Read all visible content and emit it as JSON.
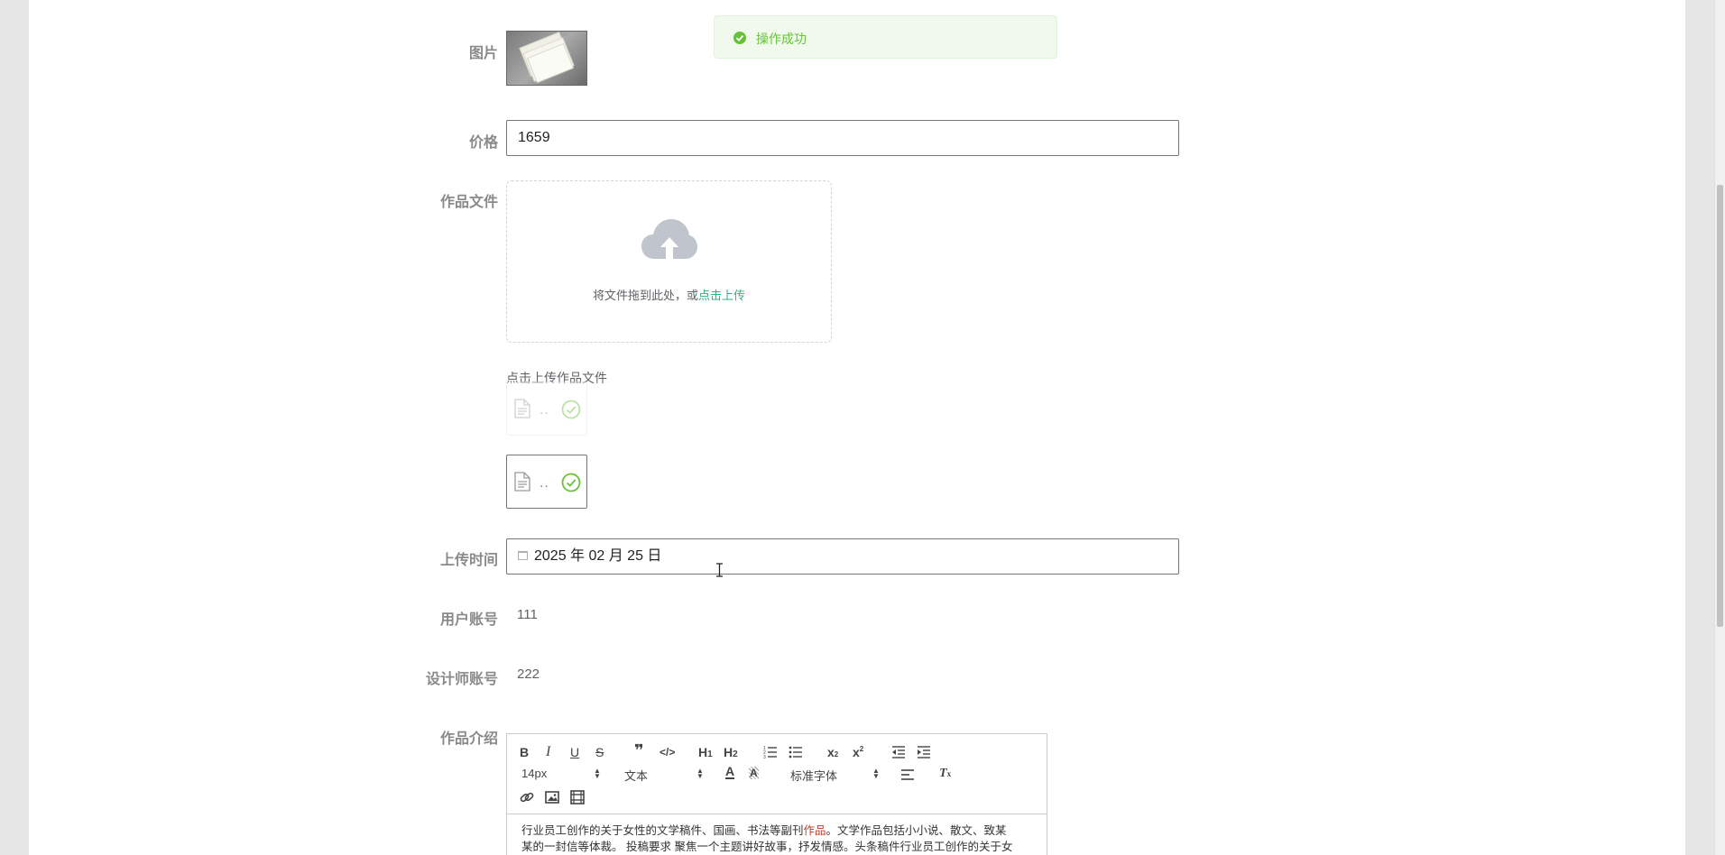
{
  "toast": {
    "message": "操作成功",
    "color": "#67c23a"
  },
  "form": {
    "image": {
      "label": "图片",
      "thumbnail_alt": "作品图片"
    },
    "price": {
      "label": "价格",
      "value": "1659"
    },
    "file": {
      "label": "作品文件",
      "drop_text": "将文件拖到此处，或",
      "click_text": "点击上传",
      "tip": "点击上传作品文件",
      "items": [
        {
          "name": "..",
          "status": "uploaded",
          "faded": true
        },
        {
          "name": "..",
          "status": "uploaded",
          "faded": false
        }
      ]
    },
    "upload_time": {
      "label": "上传时间",
      "value": "2025 年 02 月 25 日"
    },
    "user_account": {
      "label": "用户账号",
      "value": "111"
    },
    "designer_account": {
      "label": "设计师账号",
      "value": "222"
    },
    "intro": {
      "label": "作品介绍",
      "toolbar": {
        "font_size": "14px",
        "format": "文本",
        "font_family": "标准字体"
      },
      "content_line1_before": "行业员工创作的关于女性的文学稿件、国画、书法等副刊",
      "content_line1_highlight": "作品",
      "content_line1_after": "。文学作品包括小小说、散文、致某",
      "content_line2": "某的一封信等体裁。 投稿要求 聚焦一个主题讲好故事，抒发情感。头条稿件行业员工创作的关于女"
    }
  },
  "colors": {
    "accent_link": "#2fb17c",
    "label_gray": "#8a8a8a",
    "success_green": "#67c23a"
  }
}
